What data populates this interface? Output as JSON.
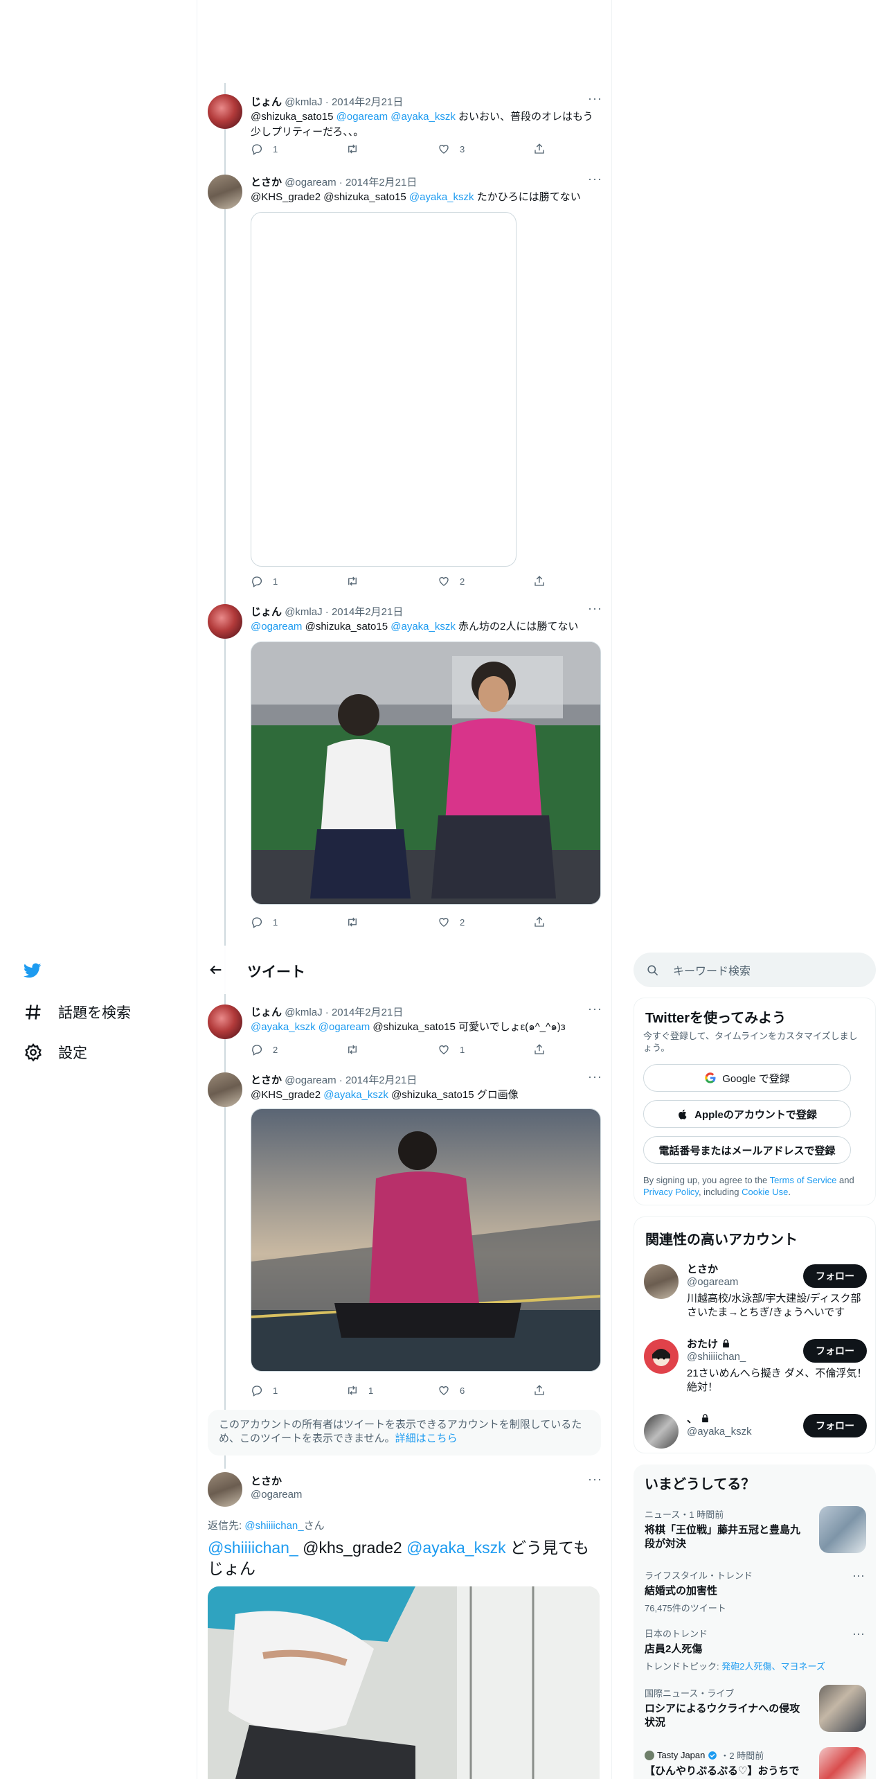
{
  "nav": {
    "explore_label": "話題を検索",
    "settings_label": "設定"
  },
  "header": {
    "title": "ツイート"
  },
  "search": {
    "placeholder": "キーワード検索"
  },
  "tweets": [
    {
      "name": "じょん",
      "handle": "@kmlaJ",
      "date": "2014年2月21日",
      "body_segments": [
        {
          "text": "@shizuka_sato15 ",
          "link": false
        },
        {
          "text": "@ogaream",
          "link": true
        },
        {
          "text": " ",
          "link": false
        },
        {
          "text": "@ayaka_kszk",
          "link": true
        },
        {
          "text": " おいおい、普段のオレはもう少しプリティーだろ、、。",
          "link": false
        }
      ],
      "replies": "1",
      "retweets": "",
      "likes": "3"
    },
    {
      "name": "とさか",
      "handle": "@ogaream",
      "date": "2014年2月21日",
      "body_segments": [
        {
          "text": "@KHS_grade2 @shizuka_sato15 ",
          "link": false
        },
        {
          "text": "@ayaka_kszk",
          "link": true
        },
        {
          "text": " たかひろには勝てない",
          "link": false
        }
      ],
      "replies": "1",
      "retweets": "",
      "likes": "2"
    },
    {
      "name": "じょん",
      "handle": "@kmlaJ",
      "date": "2014年2月21日",
      "body_segments": [
        {
          "text": "@ogaream",
          "link": true
        },
        {
          "text": " @shizuka_sato15 ",
          "link": false
        },
        {
          "text": "@ayaka_kszk",
          "link": true
        },
        {
          "text": " 赤ん坊の2人には勝てない",
          "link": false
        }
      ],
      "replies": "1",
      "retweets": "",
      "likes": "2"
    },
    {
      "name": "じょん",
      "handle": "@kmlaJ",
      "date": "2014年2月21日",
      "body_segments": [
        {
          "text": "@ayaka_kszk",
          "link": true
        },
        {
          "text": " ",
          "link": false
        },
        {
          "text": "@ogaream",
          "link": true
        },
        {
          "text": " @shizuka_sato15 可愛いでしょε(๑^_^๑)з",
          "link": false
        }
      ],
      "replies": "2",
      "retweets": "",
      "likes": "1"
    },
    {
      "name": "とさか",
      "handle": "@ogaream",
      "date": "2014年2月21日",
      "body_segments": [
        {
          "text": "@KHS_grade2 ",
          "link": false
        },
        {
          "text": "@ayaka_kszk",
          "link": true
        },
        {
          "text": " @shizuka_sato15 グロ画像",
          "link": false
        }
      ],
      "replies": "1",
      "retweets": "1",
      "likes": "6"
    }
  ],
  "restricted_notice": {
    "text": "このアカウントの所有者はツイートを表示できるアカウントを制限しているため、このツイートを表示できません。",
    "link": "詳細はこちら"
  },
  "main_tweet": {
    "name": "とさか",
    "handle": "@ogaream",
    "reply_prefix": "返信先: ",
    "reply_to": "@shiiiichan_",
    "reply_suffix": "さん",
    "body_segments": [
      {
        "text": "@shiiiichan_",
        "link": true
      },
      {
        "text": " @khs_grade2 ",
        "link": false
      },
      {
        "text": "@ayaka_kszk",
        "link": true
      },
      {
        "text": " どう見てもじょん",
        "link": false
      }
    ]
  },
  "signup_card": {
    "title": "Twitterを使ってみよう",
    "subtitle": "今すぐ登録して、タイムラインをカスタマイズしましょう。",
    "google_label": "Google で登録",
    "apple_label": "Appleのアカウントで登録",
    "phone_label": "電話番号またはメールアドレスで登録",
    "terms_prefix": "By signing up, you agree to the ",
    "terms_link": "Terms of Service",
    "terms_mid": " and ",
    "privacy_link": "Privacy Policy",
    "terms_mid2": ", including ",
    "cookie_link": "Cookie Use",
    "terms_end": "."
  },
  "relevant_accounts": {
    "title": "関連性の高いアカウント",
    "follow_label": "フォロー",
    "accounts": [
      {
        "name": "とさか",
        "handle": "@ogaream",
        "bio": "川越高校/水泳部/宇大建設/ディスク部　さいたま→とちぎ/きょうへいです"
      },
      {
        "name": "おたけ",
        "handle": "@shiiiichan_",
        "bio": "21さいめんへら擬き ダメ、不倫浮気！絶対！"
      },
      {
        "name": "、",
        "handle": "@ayaka_kszk",
        "bio": ""
      }
    ]
  },
  "trends": {
    "title": "いまどうしてる？",
    "items": [
      {
        "meta": "ニュース・1 時間前",
        "title": "将棋「王位戦」藤井五冠と豊島九段が対決",
        "sub": ""
      },
      {
        "meta": "ライフスタイル・トレンド",
        "title": "結婚式の加害性",
        "sub": "76,475件のツイート"
      },
      {
        "meta": "日本のトレンド",
        "title": "店員2人死傷",
        "sub_prefix": "トレンドトピック: ",
        "sub_link": "発砲2人死傷、マヨネーズ"
      },
      {
        "meta": "国際ニュース・ライブ",
        "title": "ロシアによるウクライナへの侵攻状況",
        "sub": ""
      },
      {
        "meta_name": "Tasty Japan",
        "meta": "・2 時間前",
        "title": "【ひんやりぷるぷる♡】おうちで",
        "sub": ""
      }
    ]
  }
}
